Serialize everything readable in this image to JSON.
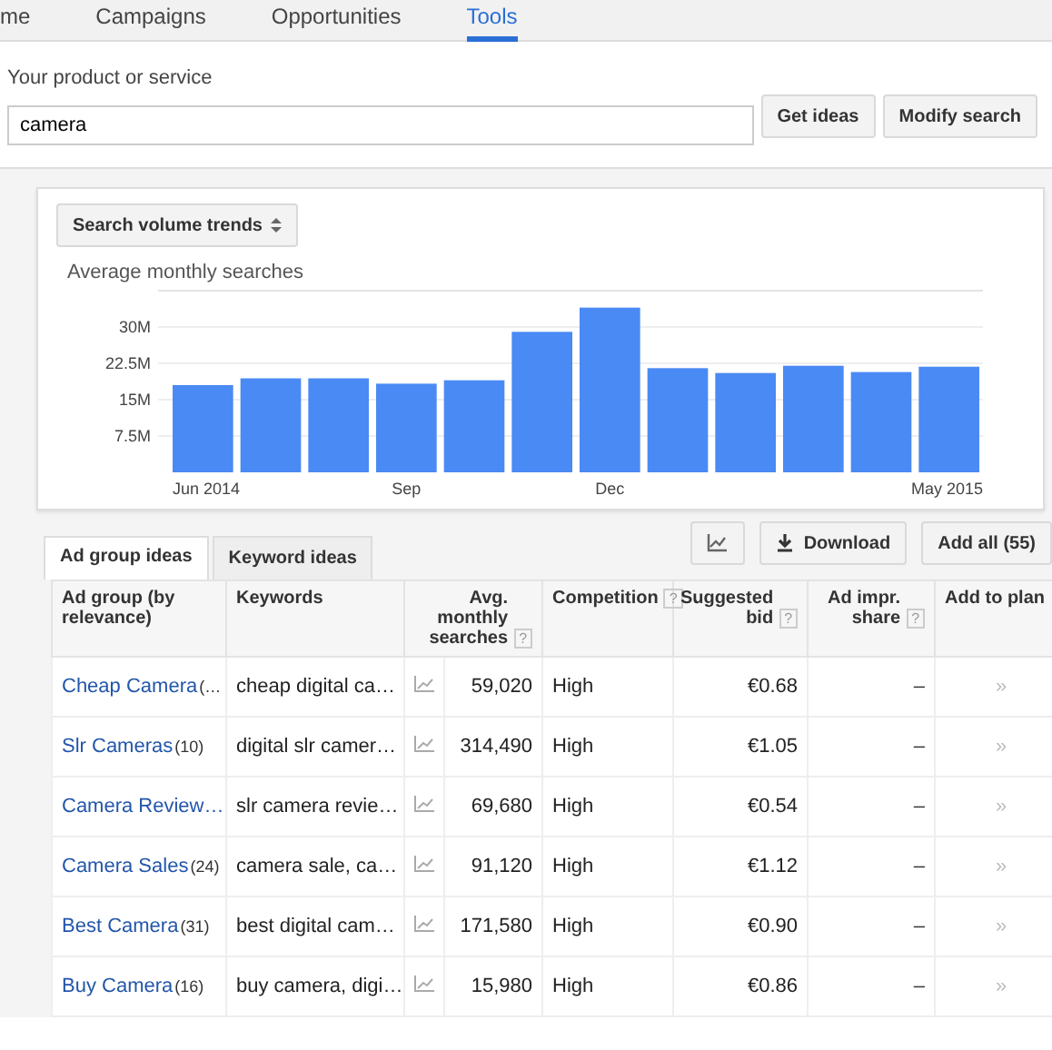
{
  "nav": {
    "tabs": [
      {
        "label": "me",
        "selected": false
      },
      {
        "label": "Campaigns",
        "selected": false
      },
      {
        "label": "Opportunities",
        "selected": false
      },
      {
        "label": "Tools",
        "selected": true
      }
    ]
  },
  "search": {
    "label": "Your product or service",
    "value": "camera",
    "buttons": [
      "Get ideas",
      "Modify search"
    ]
  },
  "trends": {
    "selector": "Search volume trends",
    "chart_data": {
      "type": "bar",
      "title": "Average monthly searches",
      "categories": [
        "Jun 2014",
        null,
        null,
        "Sep",
        null,
        null,
        "Dec",
        null,
        null,
        null,
        null,
        "May 2015"
      ],
      "series": [
        {
          "color": "#4a8af4",
          "values": [
            18,
            19.4,
            19.4,
            18.3,
            19,
            29,
            34,
            21.5,
            20.5,
            22,
            20.7,
            21.8
          ]
        }
      ],
      "ylim": [
        0,
        37.5
      ],
      "grid": true,
      "yticks": [
        {
          "value": 7.5,
          "label": "7.5M"
        },
        {
          "value": 15,
          "label": "15M"
        },
        {
          "value": 22.5,
          "label": "22.5M"
        },
        {
          "value": 30,
          "label": "30M"
        }
      ]
    }
  },
  "toolbar": {
    "download": "Download",
    "add_all": "Add all (55)"
  },
  "tabs": [
    {
      "label": "Ad group ideas",
      "selected": true
    },
    {
      "label": "Keyword ideas",
      "selected": false
    }
  ],
  "table": {
    "columns": [
      {
        "label": "Ad group (by relevance)"
      },
      {
        "label": "Keywords"
      },
      {
        "label": "Avg. monthly searches",
        "help": "?"
      },
      {
        "label": "Competition",
        "help": "?"
      },
      {
        "label": "Suggested bid",
        "help": "?"
      },
      {
        "label": "Ad impr. share",
        "help": "?"
      },
      {
        "label": "Add to plan"
      }
    ],
    "rows": [
      {
        "name": "Cheap Camera",
        "count": "(…",
        "keywords": "cheap digital ca…",
        "searches": "59,020",
        "competition": "High",
        "bid": "€0.68",
        "share": "–",
        "add": "»"
      },
      {
        "name": "Slr Cameras",
        "count": "(10)",
        "keywords": "digital slr camer…",
        "searches": "314,490",
        "competition": "High",
        "bid": "€1.05",
        "share": "–",
        "add": "»"
      },
      {
        "name": "Camera Review…",
        "keywords": "slr camera revie…",
        "searches": "69,680",
        "competition": "High",
        "bid": "€0.54",
        "share": "–",
        "add": "»"
      },
      {
        "name": "Camera Sales",
        "count": "(24)",
        "keywords": "camera sale, ca…",
        "searches": "91,120",
        "competition": "High",
        "bid": "€1.12",
        "share": "–",
        "add": "»"
      },
      {
        "name": "Best Camera",
        "count": "(31)",
        "keywords": "best digital cam…",
        "searches": "171,580",
        "competition": "High",
        "bid": "€0.90",
        "share": "–",
        "add": "»"
      },
      {
        "name": "Buy Camera",
        "count": "(16)",
        "keywords": "buy camera, digi…",
        "searches": "15,980",
        "competition": "High",
        "bid": "€0.86",
        "share": "–",
        "add": "»"
      }
    ]
  }
}
